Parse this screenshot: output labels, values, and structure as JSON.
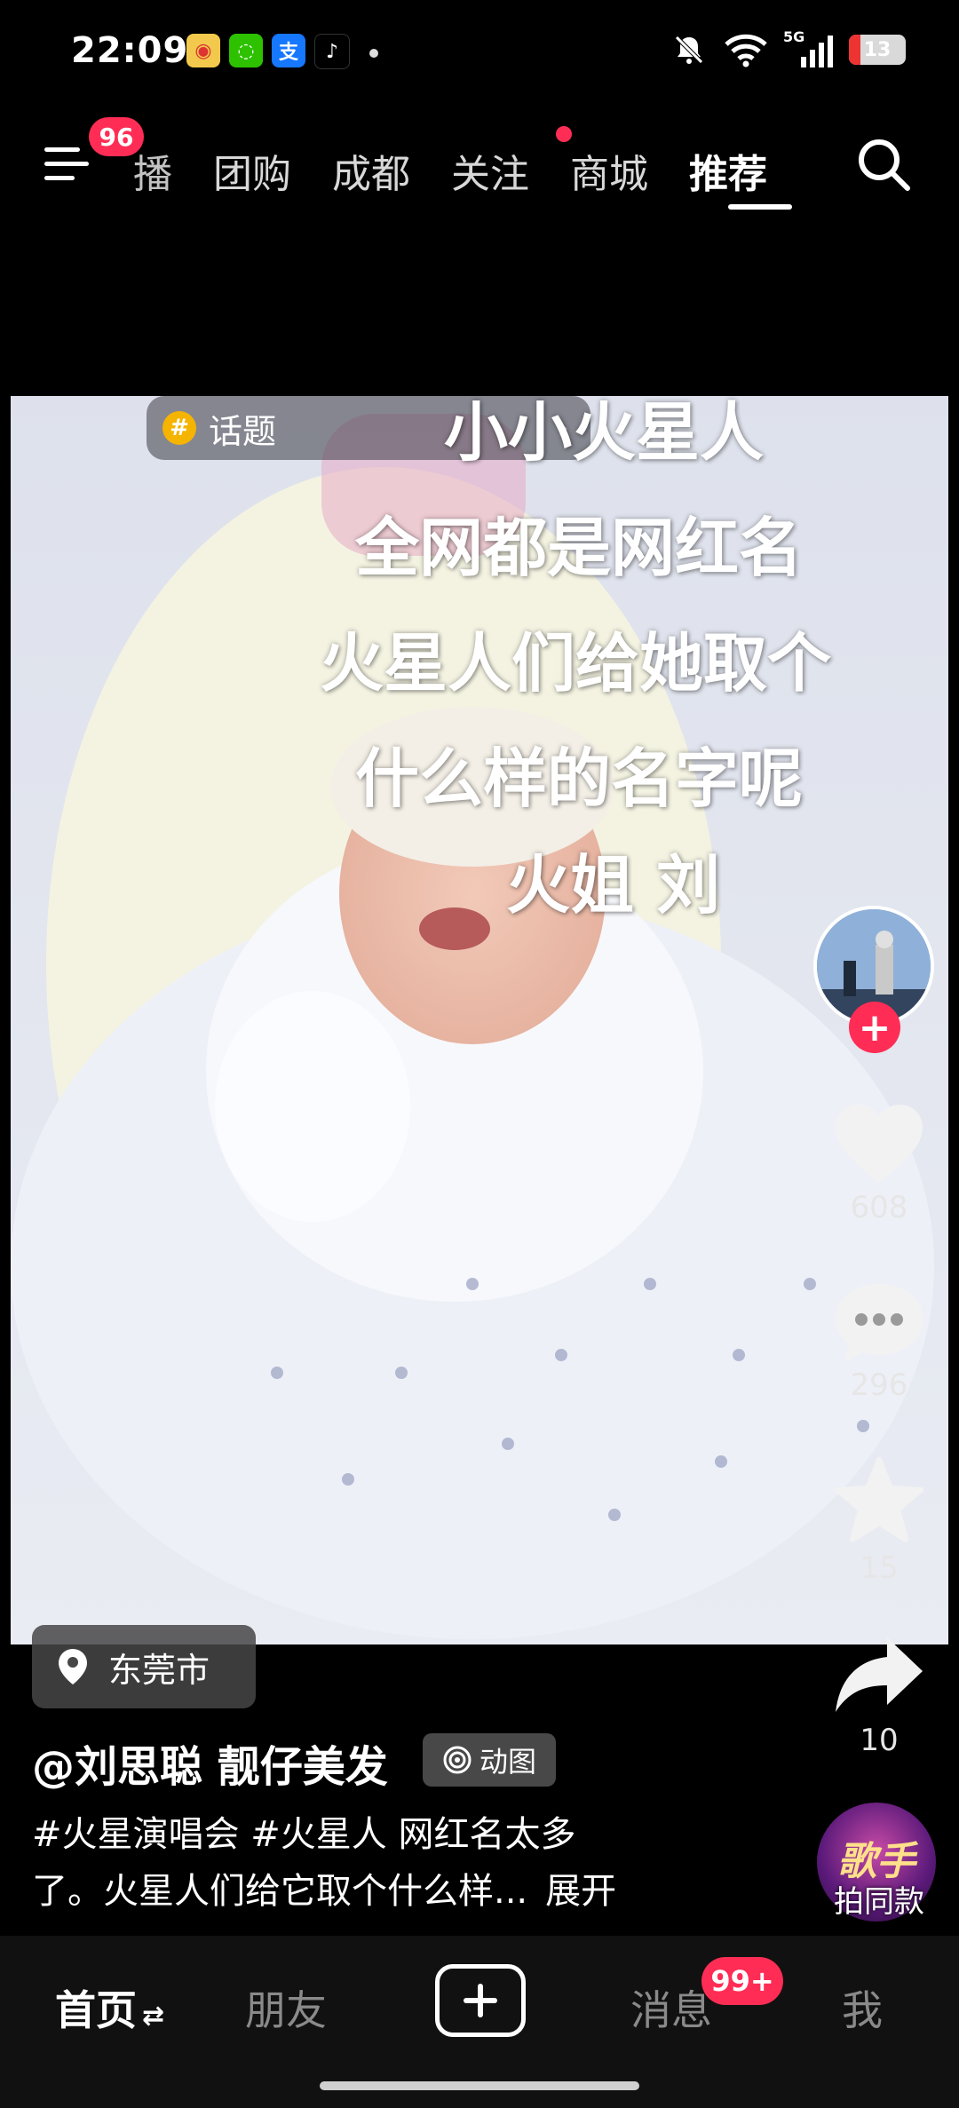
{
  "status_bar": {
    "time": "22:09",
    "notification_apps": [
      "weibo-icon",
      "wechat-icon",
      "alipay-icon",
      "tiktok-icon"
    ],
    "network": "5G",
    "battery": "13"
  },
  "top_nav": {
    "menu_badge": "96",
    "tabs": [
      {
        "label": "播",
        "name": "tab-live"
      },
      {
        "label": "团购",
        "name": "tab-groupbuy"
      },
      {
        "label": "成都",
        "name": "tab-city"
      },
      {
        "label": "关注",
        "name": "tab-following"
      },
      {
        "label": "商城",
        "name": "tab-mall"
      },
      {
        "label": "推荐",
        "name": "tab-recommend"
      }
    ],
    "active_tab": "推荐"
  },
  "video": {
    "topic_label": "话题",
    "overlay_lines": [
      "小小火星人",
      "全网都是网红名",
      "火星人们给她取个",
      "什么样的名字呢",
      "火姐 刘"
    ]
  },
  "rail": {
    "likes": "608",
    "comments": "296",
    "favorites": "15",
    "shares": "10"
  },
  "post": {
    "location": "东莞市",
    "author": "@刘思聪 靓仔美发",
    "gif_badge": "动图",
    "caption_line1": "#火星演唱会  #火星人  网红名太多",
    "caption_line2": "了。火星人们给它取个什么样...",
    "expand": "展开",
    "music_label": "拍同款",
    "music_logo": "歌手"
  },
  "bottom_nav": {
    "home": "首页",
    "friends": "朋友",
    "messages": "消息",
    "messages_badge": "99+",
    "me": "我"
  },
  "colors": {
    "accent": "#ff2d55",
    "background": "#000000",
    "topic_icon": "#f5b400"
  }
}
